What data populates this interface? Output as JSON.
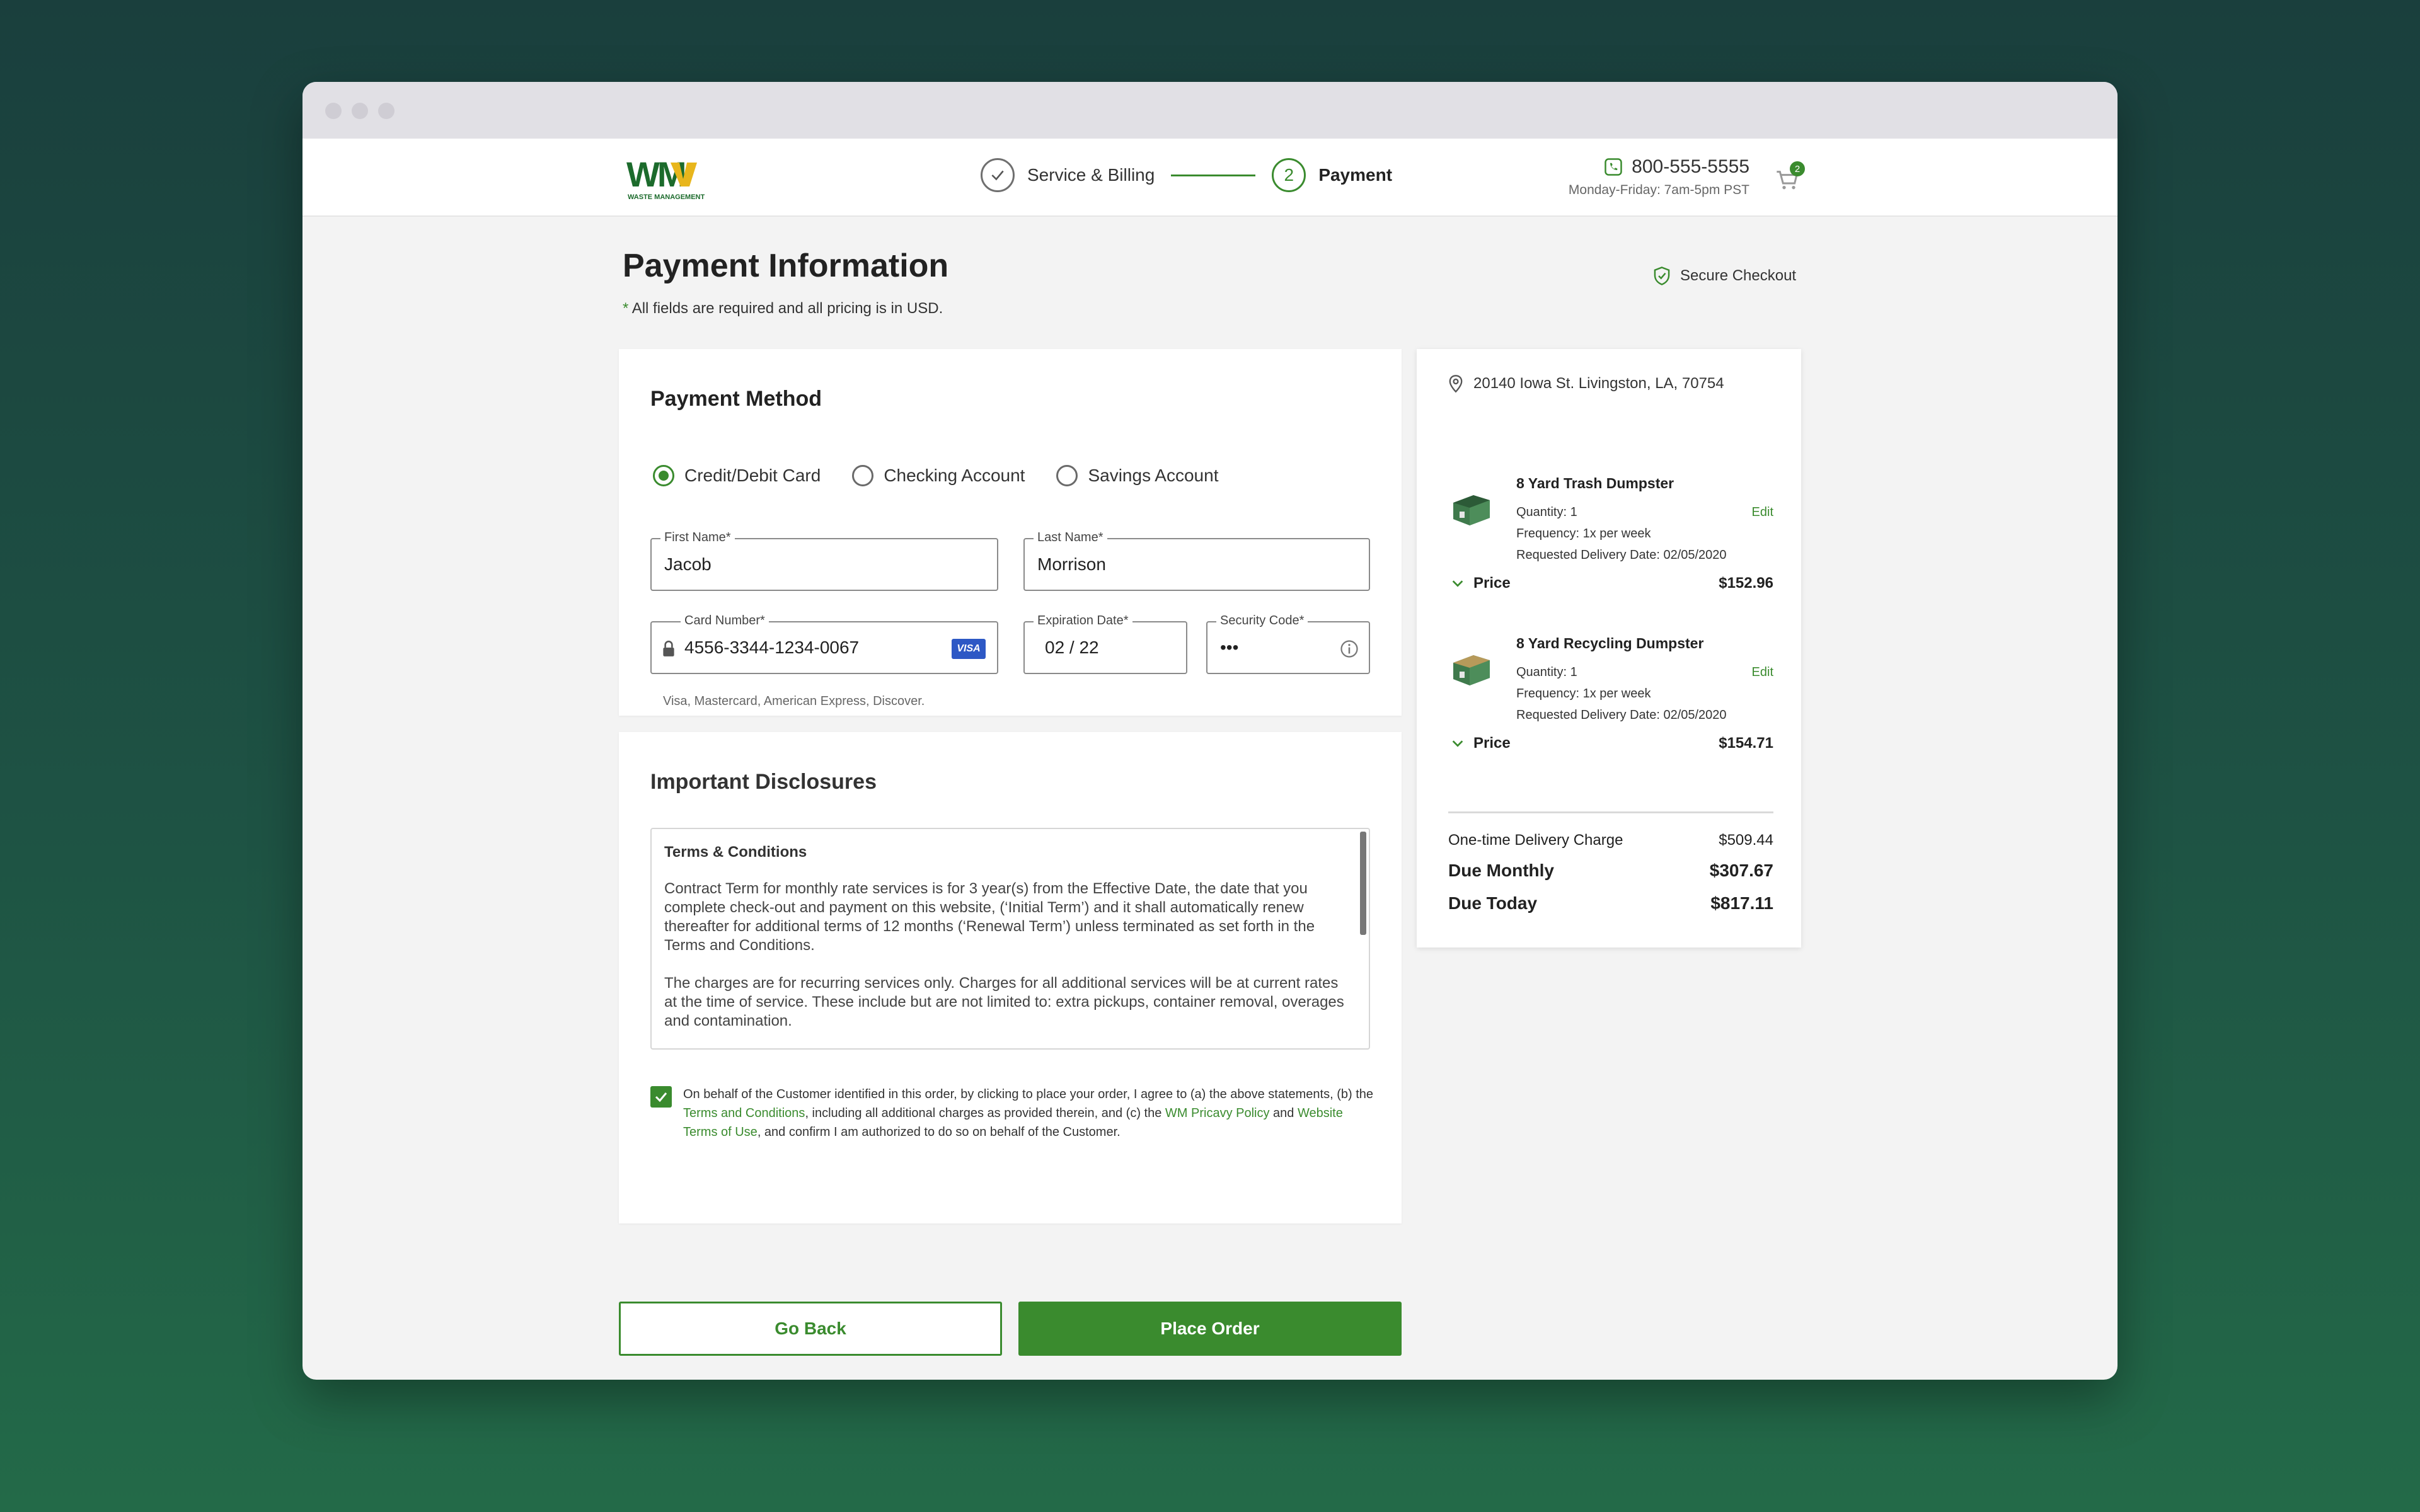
{
  "header": {
    "logo_text": "WM",
    "logo_sub": "WASTE MANAGEMENT",
    "steps": [
      {
        "label": "Service & Billing"
      },
      {
        "number": "2",
        "label": "Payment"
      }
    ],
    "phone": "800-555-5555",
    "hours": "Monday-Friday: 7am-5pm PST",
    "cart_count": "2"
  },
  "page": {
    "title": "Payment Information",
    "required_mark": "*",
    "note": " All fields are required and all pricing is in USD.",
    "secure": "Secure Checkout"
  },
  "payment": {
    "title": "Payment Method",
    "methods": [
      "Credit/Debit Card",
      "Checking Account",
      "Savings Account"
    ],
    "selected": "Credit/Debit Card",
    "first_name": {
      "label": "First Name*",
      "value": "Jacob"
    },
    "last_name": {
      "label": "Last Name*",
      "value": "Morrison"
    },
    "card_number": {
      "label": "Card Number*",
      "value": "4556-3344-1234-0067",
      "brand": "VISA"
    },
    "expiration": {
      "label": "Expiration Date*",
      "value": "02 / 22"
    },
    "security": {
      "label": "Security Code*",
      "value": "•••"
    },
    "card_hint": "Visa, Mastercard, American Express, Discover."
  },
  "disclosures": {
    "title": "Important Disclosures",
    "terms_title": "Terms & Conditions",
    "paragraphs": [
      "Contract Term for monthly rate services is for 3 year(s) from the Effective Date, the date that you complete check-out and payment on this website, (‘Initial Term’) and it shall automatically renew thereafter for additional terms of 12 months (‘Renewal Term’) unless terminated as set forth in the Terms and Conditions.",
      "The charges are for recurring services only. Charges for all additional services will be at current rates at the time of service. These include but are not limited to: extra pickups, container removal, overages and contamination."
    ],
    "agree": {
      "t1": "On behalf of the Customer identified in this order, by clicking to place your order, I agree to (a) the above statements, (b) the ",
      "l1": "Terms and Conditions",
      "t2": ", including all additional charges as provided therein, and (c) the ",
      "l2": "WM Pricavy Policy",
      "t3": " and ",
      "l3": "Website Terms of Use",
      "t4": ", and confirm I am authorized to do so on behalf of the Customer."
    }
  },
  "actions": {
    "back": "Go Back",
    "order": "Place Order"
  },
  "summary": {
    "address": "20140 Iowa St. Livingston, LA, 70754",
    "items": [
      {
        "name": "8 Yard Trash Dumpster",
        "quantity": "Quantity: 1",
        "frequency": "Frequency: 1x per week",
        "delivery": "Requested Delivery Date: 02/05/2020",
        "edit": "Edit",
        "price_label": "Price",
        "price": "$152.96"
      },
      {
        "name": "8 Yard Recycling Dumpster",
        "quantity": "Quantity: 1",
        "frequency": "Frequency: 1x per week",
        "delivery": "Requested Delivery Date: 02/05/2020",
        "edit": "Edit",
        "price_label": "Price",
        "price": "$154.71"
      }
    ],
    "delivery_label": "One-time Delivery Charge",
    "delivery_value": "$509.44",
    "monthly_label": "Due Monthly",
    "monthly_value": "$307.67",
    "today_label": "Due Today",
    "today_value": "$817.11"
  },
  "colors": {
    "accent": "#3a8b2e",
    "logo_gold": "#e8b61c",
    "logo_green": "#1c6b2c"
  }
}
